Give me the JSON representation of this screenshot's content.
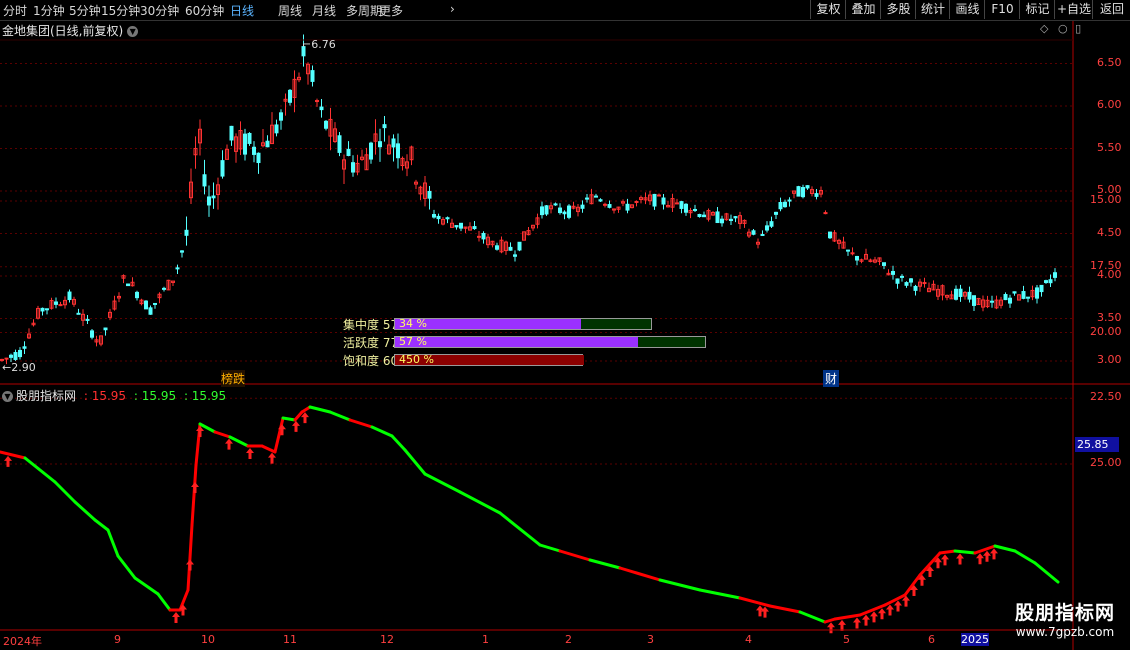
{
  "toolbar": {
    "timeframes": [
      "分时",
      "1分钟",
      "5分钟",
      "15分钟",
      "30分钟",
      "60分钟",
      "日线",
      "周线",
      "月线",
      "多周期",
      "更多"
    ],
    "active": "日线",
    "right_buttons": [
      "复权",
      "叠加",
      "多股",
      "统计",
      "画线",
      "F10",
      "标记",
      "+自选",
      "返回"
    ]
  },
  "stock": {
    "title": "金地集团(日线,前复权)"
  },
  "price_axis": {
    "labels": [
      "6.50",
      "6.00",
      "5.50",
      "5.00",
      "4.50",
      "4.00",
      "3.50",
      "3.00"
    ],
    "values": [
      6.5,
      6.0,
      5.5,
      5.0,
      4.5,
      4.0,
      3.5,
      3.0
    ]
  },
  "price_markers": {
    "high_label": "6.76",
    "low_label": "2.90"
  },
  "events": {
    "bang": "榜跌",
    "cai": "财"
  },
  "chips": [
    {
      "label": "集中度",
      "value_prefix": "57",
      "fill_text": "34 %",
      "fill": 0.72
    },
    {
      "label": "活跃度",
      "value_prefix": "77",
      "fill_text": "57 %",
      "fill": 0.78
    },
    {
      "label": "饱和度",
      "value_prefix": "60",
      "fill_text": "450 %",
      "fill": 1.0
    }
  ],
  "indicator": {
    "name": "股朋指标网",
    "v1": ": 15.95",
    "v2": ": 15.95",
    "v3": ": 15.95",
    "current": "25.85",
    "axis_labels": [
      "25.00",
      "22.50",
      "20.00",
      "17.50",
      "15.00"
    ],
    "axis_values": [
      25.0,
      22.5,
      20.0,
      17.5,
      15.0
    ]
  },
  "time_axis": {
    "labels": [
      "2024年",
      "9",
      "10",
      "11",
      "12",
      "1",
      "2",
      "3",
      "4",
      "5",
      "6",
      "2025"
    ]
  },
  "watermark": {
    "line1": "股朋指标网",
    "line2": "www.7gpzb.com"
  },
  "colors": {
    "up": "#ff3232",
    "down": "#54ffff",
    "line_green": "#00ff00",
    "line_red": "#ff0000",
    "grid": "#5a0000"
  }
}
